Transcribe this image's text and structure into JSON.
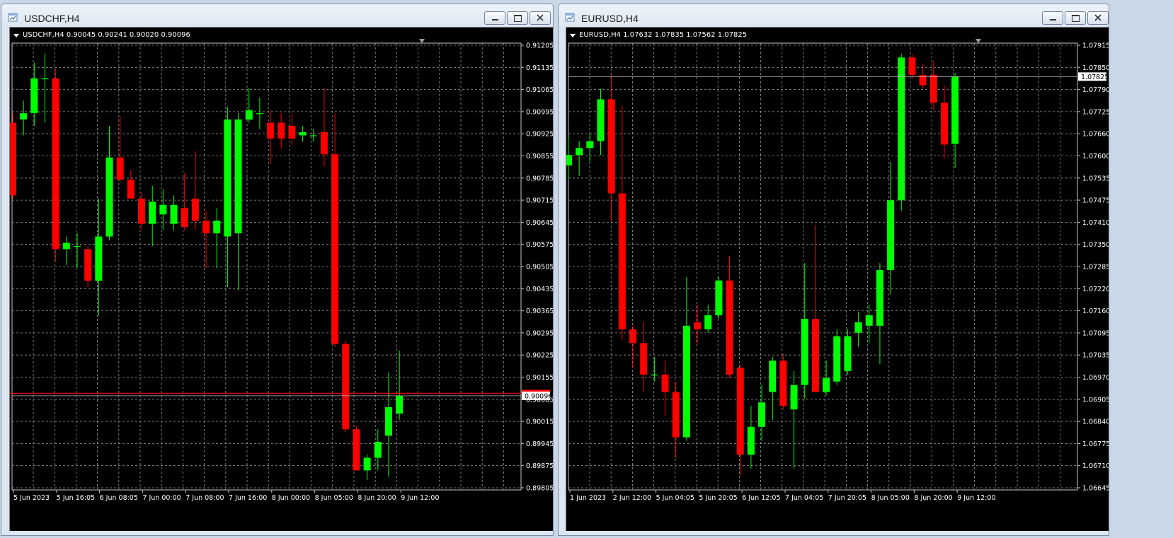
{
  "windows": [
    {
      "title": "USDCHF,H4",
      "info": "USDCHF,H4  0.90045 0.90241 0.90020 0.90096",
      "current_price": "0.90096",
      "price_axis": {
        "labels": [
          "0.91205",
          "0.91135",
          "0.91065",
          "0.90995",
          "0.90925",
          "0.90855",
          "0.90785",
          "0.90715",
          "0.90645",
          "0.90575",
          "0.90505",
          "0.90435",
          "0.90365",
          "0.90295",
          "0.90225",
          "0.90155",
          "0.90085",
          "0.90015",
          "0.89945",
          "0.89875",
          "0.89805"
        ],
        "max": 0.91205,
        "min": 0.89805
      },
      "time_axis": [
        "5 Jun 2023",
        "5 Jun 16:05",
        "6 Jun 08:05",
        "7 Jun 00:00",
        "7 Jun 08:00",
        "7 Jun 16:00",
        "8 Jun 00:00",
        "8 Jun 05:00",
        "8 Jun 20:00",
        "9 Jun 12:00"
      ],
      "alert_line": 0.90104,
      "candles": [
        [
          0.9096,
          0.9099,
          0.9072,
          0.9073
        ],
        [
          0.9097,
          0.9103,
          0.9092,
          0.9099
        ],
        [
          0.9099,
          0.9115,
          0.9095,
          0.911
        ],
        [
          0.911,
          0.9118,
          0.9096,
          0.911
        ],
        [
          0.911,
          0.9113,
          0.9052,
          0.9056
        ],
        [
          0.9056,
          0.906,
          0.9051,
          0.9058
        ],
        [
          0.9057,
          0.9061,
          0.905,
          0.9057
        ],
        [
          0.9056,
          0.9057,
          0.9044,
          0.9046
        ],
        [
          0.9046,
          0.9072,
          0.9035,
          0.906
        ],
        [
          0.906,
          0.9095,
          0.9059,
          0.9085
        ],
        [
          0.9085,
          0.9098,
          0.9077,
          0.9078
        ],
        [
          0.9078,
          0.9081,
          0.9072,
          0.9072
        ],
        [
          0.9072,
          0.9074,
          0.9062,
          0.9064
        ],
        [
          0.9064,
          0.9076,
          0.9057,
          0.9071
        ],
        [
          0.9067,
          0.9075,
          0.9062,
          0.907
        ],
        [
          0.9064,
          0.9073,
          0.9062,
          0.907
        ],
        [
          0.9069,
          0.908,
          0.9062,
          0.9063
        ],
        [
          0.9072,
          0.9087,
          0.9062,
          0.9065
        ],
        [
          0.9065,
          0.9068,
          0.905,
          0.9061
        ],
        [
          0.9061,
          0.9069,
          0.905,
          0.9065
        ],
        [
          0.906,
          0.9101,
          0.9044,
          0.9097
        ],
        [
          0.9061,
          0.9099,
          0.9043,
          0.9097
        ],
        [
          0.9097,
          0.9107,
          0.9096,
          0.91
        ],
        [
          0.9099,
          0.9104,
          0.9094,
          0.9099
        ],
        [
          0.9096,
          0.91,
          0.9083,
          0.9091
        ],
        [
          0.9096,
          0.9099,
          0.9088,
          0.9091
        ],
        [
          0.9095,
          0.9099,
          0.9089,
          0.9091
        ],
        [
          0.9092,
          0.9095,
          0.909,
          0.9093
        ],
        [
          0.9092,
          0.9094,
          0.909,
          0.9092
        ],
        [
          0.9093,
          0.9107,
          0.9082,
          0.9086
        ],
        [
          0.9086,
          0.9099,
          0.9025,
          0.9026
        ],
        [
          0.9026,
          0.9027,
          0.8998,
          0.8999
        ],
        [
          0.8999,
          0.9,
          0.8986,
          0.8986
        ],
        [
          0.8986,
          0.8991,
          0.8983,
          0.899
        ],
        [
          0.899,
          0.8999,
          0.8986,
          0.8995
        ],
        [
          0.8997,
          0.9017,
          0.8984,
          0.9006
        ],
        [
          0.9004,
          0.9024,
          0.9002,
          0.90096
        ]
      ]
    },
    {
      "title": "EURUSD,H4",
      "info": "EURUSD,H4  1.07632 1.07835 1.07562 1.07825",
      "current_price": "1.07825",
      "price_axis": {
        "labels": [
          "1.07915",
          "1.07850",
          "1.07790",
          "1.07725",
          "1.07660",
          "1.07600",
          "1.07535",
          "1.07475",
          "1.07410",
          "1.07350",
          "1.07285",
          "1.07220",
          "1.07160",
          "1.07095",
          "1.07035",
          "1.06970",
          "1.06905",
          "1.06840",
          "1.06775",
          "1.06710",
          "1.06645"
        ],
        "max": 1.07915,
        "min": 1.06645
      },
      "time_axis": [
        "1 Jun 2023",
        "2 Jun 12:00",
        "5 Jun 04:05",
        "5 Jun 20:05",
        "6 Jun 12:05",
        "7 Jun 04:05",
        "7 Jun 20:05",
        "8 Jun 05:00",
        "8 Jun 20:00",
        "9 Jun 12:00"
      ],
      "alert_line": null,
      "candles": [
        [
          1.0757,
          1.0765,
          1.0753,
          1.076
        ],
        [
          1.076,
          1.0764,
          1.0754,
          1.0762
        ],
        [
          1.0762,
          1.0766,
          1.0758,
          1.0764
        ],
        [
          1.0764,
          1.0779,
          1.076,
          1.0776
        ],
        [
          1.0776,
          1.0783,
          1.0741,
          1.0749
        ],
        [
          1.0749,
          1.0774,
          1.0707,
          1.071
        ],
        [
          1.071,
          1.0711,
          1.0699,
          1.0706
        ],
        [
          1.0706,
          1.0712,
          1.0692,
          1.0697
        ],
        [
          1.0697,
          1.0702,
          1.0695,
          1.0697
        ],
        [
          1.0697,
          1.0701,
          1.0685,
          1.0692
        ],
        [
          1.0692,
          1.0695,
          1.0673,
          1.0679
        ],
        [
          1.0679,
          1.0725,
          1.0678,
          1.0711
        ],
        [
          1.0712,
          1.0717,
          1.0706,
          1.071
        ],
        [
          1.071,
          1.0717,
          1.0709,
          1.0714
        ],
        [
          1.0714,
          1.0725,
          1.0713,
          1.0724
        ],
        [
          1.0724,
          1.0731,
          1.0696,
          1.0697
        ],
        [
          1.0699,
          1.07,
          1.0668,
          1.0674
        ],
        [
          1.0674,
          1.0688,
          1.067,
          1.0682
        ],
        [
          1.0682,
          1.0694,
          1.0678,
          1.0689
        ],
        [
          1.0692,
          1.0702,
          1.0684,
          1.0701
        ],
        [
          1.0701,
          1.0703,
          1.0687,
          1.0688
        ],
        [
          1.0687,
          1.0698,
          1.067,
          1.0694
        ],
        [
          1.0694,
          1.0729,
          1.069,
          1.0713
        ],
        [
          1.0713,
          1.074,
          1.0692,
          1.0692
        ],
        [
          1.0692,
          1.0701,
          1.0691,
          1.0696
        ],
        [
          1.0695,
          1.071,
          1.0694,
          1.0708
        ],
        [
          1.0698,
          1.071,
          1.0697,
          1.0708
        ],
        [
          1.0709,
          1.0715,
          1.0705,
          1.0712
        ],
        [
          1.0711,
          1.0717,
          1.0706,
          1.0714
        ],
        [
          1.0711,
          1.0729,
          1.07,
          1.0727
        ],
        [
          1.0727,
          1.0758,
          1.072,
          1.0747
        ],
        [
          1.0747,
          1.0789,
          1.0744,
          1.0788
        ],
        [
          1.0788,
          1.0789,
          1.0782,
          1.0783
        ],
        [
          1.0783,
          1.0786,
          1.0779,
          1.078
        ],
        [
          1.0783,
          1.0787,
          1.0773,
          1.0775
        ],
        [
          1.0775,
          1.078,
          1.0759,
          1.0763
        ],
        [
          1.07632,
          1.07835,
          1.07562,
          1.07825
        ]
      ]
    }
  ]
}
